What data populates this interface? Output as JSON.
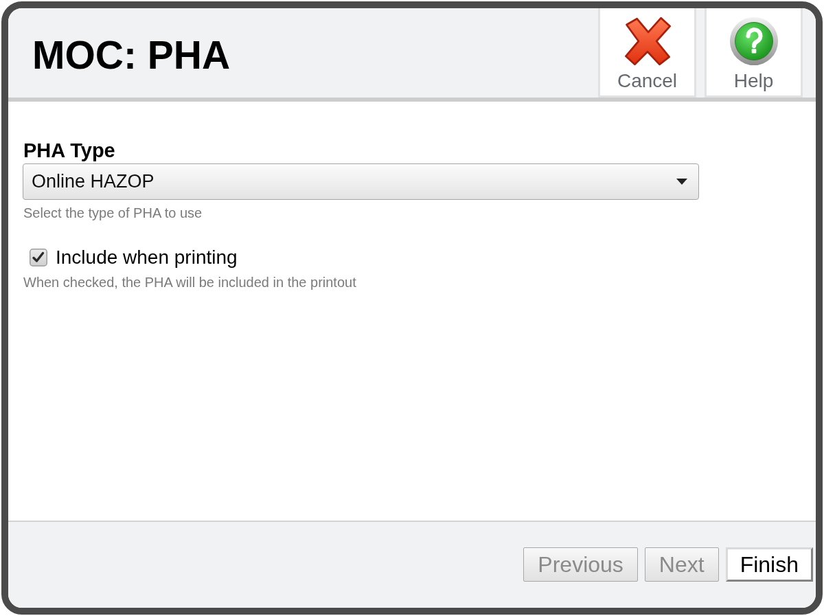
{
  "window": {
    "title": "MOC: PHA"
  },
  "toolbar": [
    {
      "kind": "cancel",
      "label": "Cancel"
    },
    {
      "kind": "help",
      "label": "Help"
    }
  ],
  "form": {
    "pha_type": {
      "label": "PHA Type",
      "value": "Online HAZOP",
      "hint": "Select the type of PHA to use"
    },
    "include_when_printing": {
      "label": "Include when printing",
      "checked": true,
      "hint": "When checked, the PHA will be included in the printout"
    }
  },
  "footer_buttons": [
    {
      "label": "Previous",
      "disabled": true
    },
    {
      "label": "Next",
      "disabled": true
    },
    {
      "label": "Finish",
      "disabled": false
    }
  ]
}
